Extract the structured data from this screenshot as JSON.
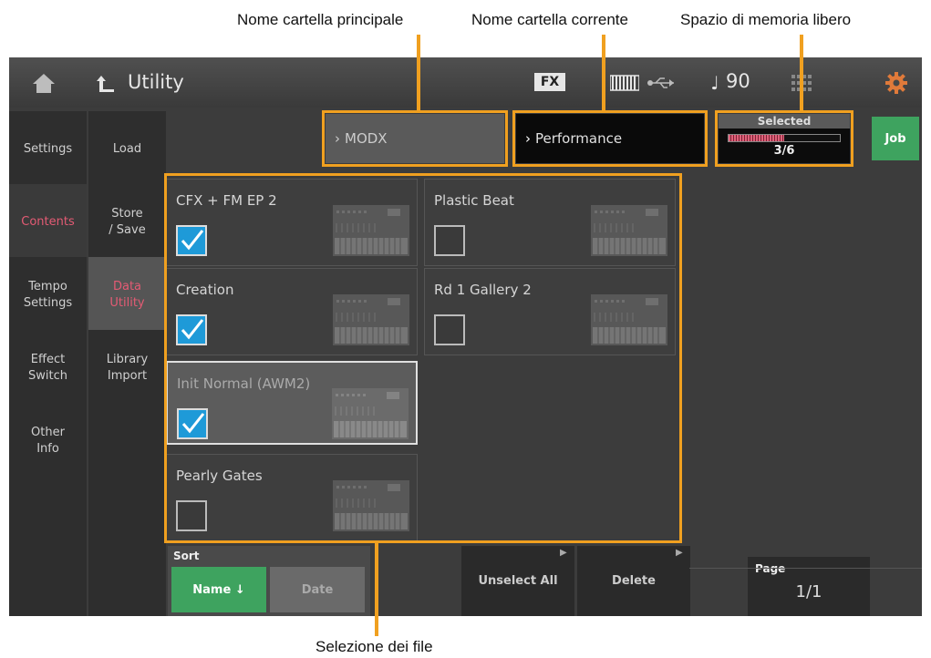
{
  "callouts": {
    "main_folder": "Nome cartella principale",
    "current_folder": "Nome cartella corrente",
    "free_memory": "Spazio di memoria libero",
    "file_selection": "Selezione dei file"
  },
  "header": {
    "title": "Utility",
    "fx_label": "FX",
    "tempo": "90",
    "icons": [
      "home-icon",
      "back-arrow-icon",
      "keyboard-icon",
      "usb-icon",
      "note-icon",
      "grid-icon",
      "gear-icon"
    ]
  },
  "tabs_left": [
    {
      "label": "Settings"
    },
    {
      "label": "Contents",
      "selected": true
    },
    {
      "label": "Tempo\nSettings"
    },
    {
      "label": "Effect\nSwitch"
    },
    {
      "label": "Other\nInfo"
    }
  ],
  "tabs_sub": [
    {
      "label": "Load"
    },
    {
      "label": "Store\n/ Save"
    },
    {
      "label": "Data\nUtility",
      "selected": true
    },
    {
      "label": "Library\nImport"
    }
  ],
  "path": {
    "parent": "MODX",
    "current": "Performance"
  },
  "memory": {
    "label": "Selected",
    "value": "3/6",
    "fill_fraction": 0.5
  },
  "job_button": "Job",
  "files": [
    {
      "name": "CFX + FM EP 2",
      "checked": true
    },
    {
      "name": "Plastic Beat",
      "checked": false
    },
    {
      "name": "Creation",
      "checked": true
    },
    {
      "name": "Rd 1 Gallery 2",
      "checked": false
    },
    {
      "name": "Init Normal (AWM2)",
      "checked": true
    },
    {
      "name": "Pearly Gates",
      "checked": false
    }
  ],
  "sort": {
    "label": "Sort",
    "name_option": "Name ↓",
    "date_option": "Date"
  },
  "unselect_all": "Unselect All",
  "delete": "Delete",
  "page": {
    "label": "Page",
    "value": "1/1"
  },
  "colors": {
    "accent_orange": "#f0a020",
    "job_green": "#3ea35f",
    "checkbox_blue": "#1e9ad8",
    "selected_tab": "#e45b74"
  }
}
